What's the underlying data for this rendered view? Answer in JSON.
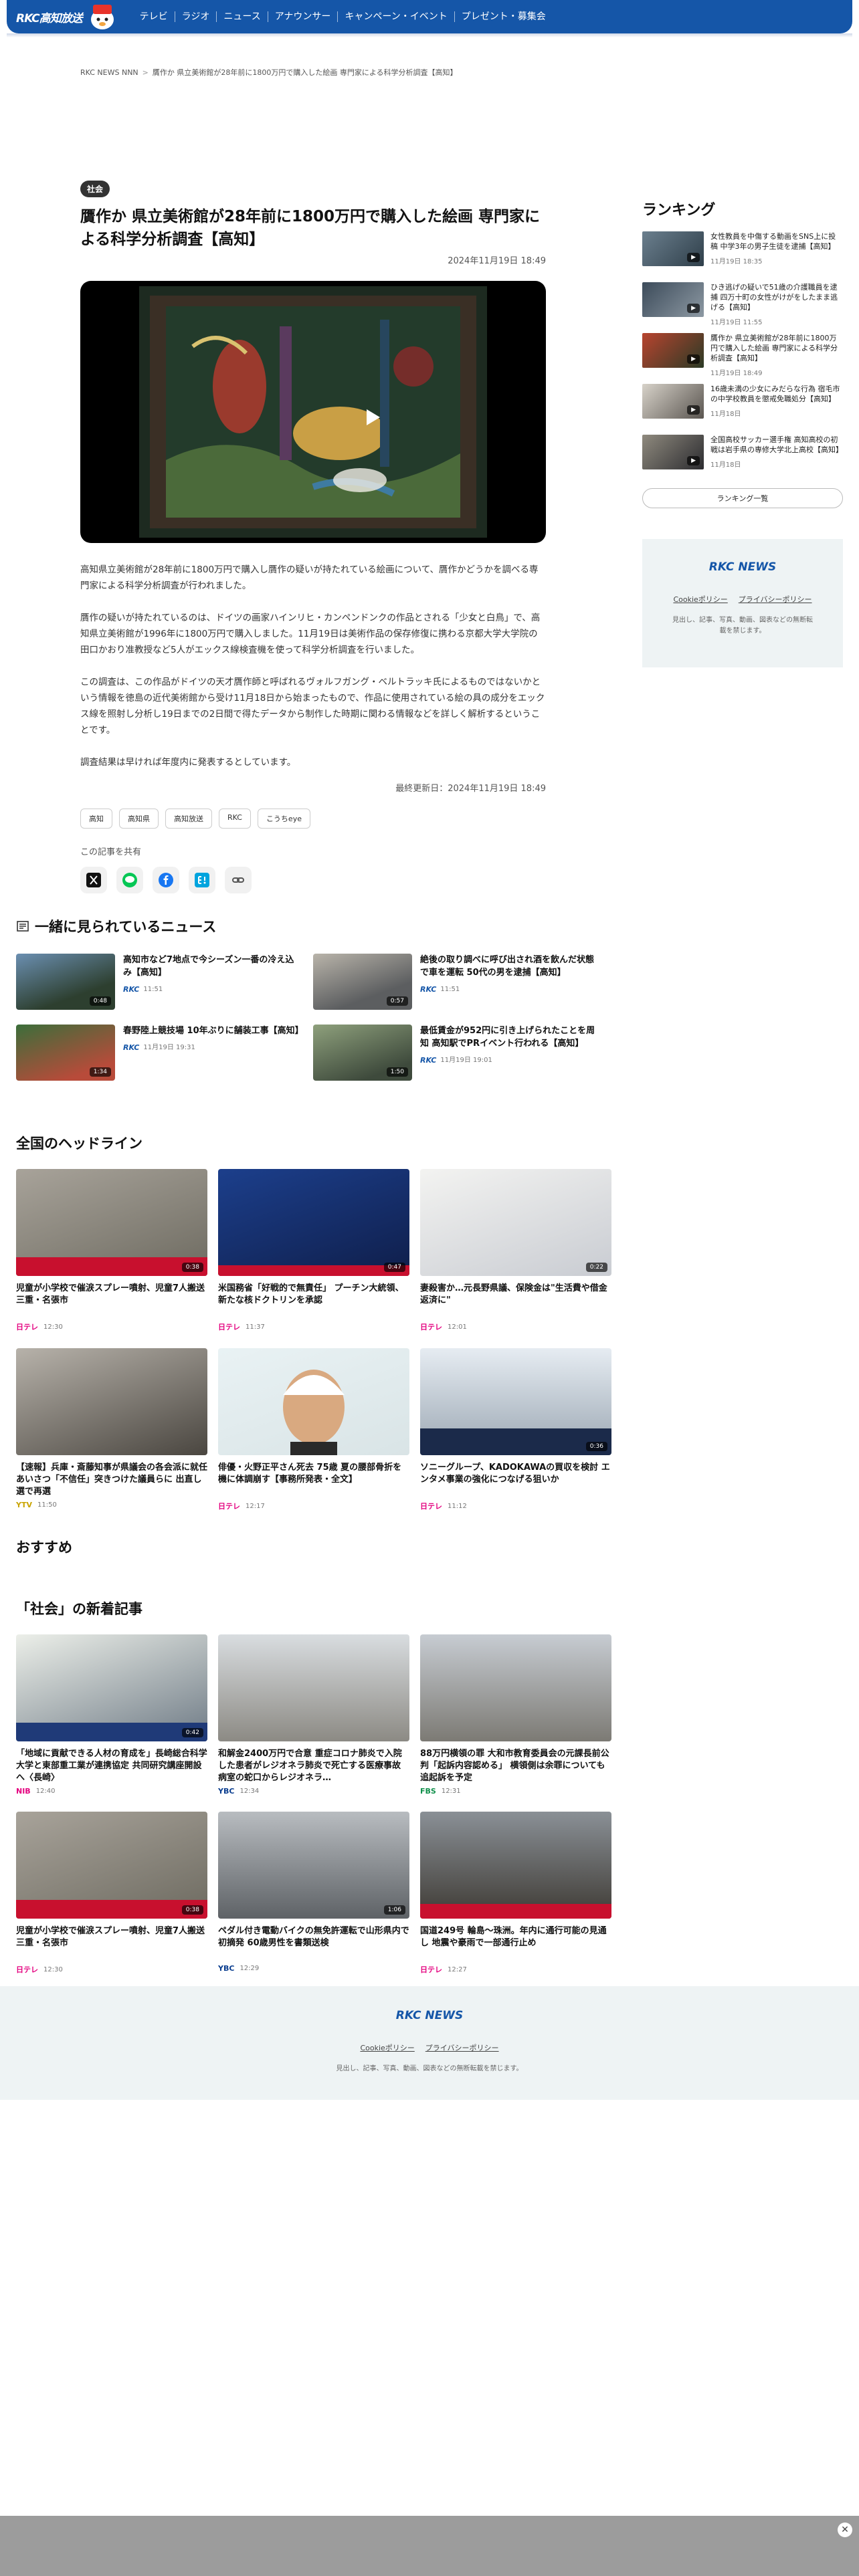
{
  "header": {
    "logo": "RKC高知放送",
    "nav": [
      "テレビ",
      "ラジオ",
      "ニュース",
      "アナウンサー",
      "キャンペーン・イベント",
      "プレゼント・募集会"
    ]
  },
  "breadcrumb": [
    "RKC NEWS NNN",
    "贋作か 県立美術館が28年前に1800万円で購入した絵画 専門家による科学分析調査【高知】"
  ],
  "article": {
    "category": "社会",
    "title": "贋作か 県立美術館が28年前に1800万円で購入した絵画 専門家による科学分析調査【高知】",
    "date": "2024年11月19日 18:49",
    "paragraphs": [
      "高知県立美術館が28年前に1800万円で購入し贋作の疑いが持たれている絵画について、贋作かどうかを調べる専門家による科学分析調査が行われました。",
      "贋作の疑いが持たれているのは、ドイツの画家ハインリヒ・カンペンドンクの作品とされる「少女と白鳥」で、高知県立美術館が1996年に1800万円で購入しました。11月19日は美術作品の保存修復に携わる京都大学大学院の田口かおり准教授など5人がエックス線検査機を使って科学分析調査を行いました。",
      "この調査は、この作品がドイツの天才贋作師と呼ばれるヴォルフガング・ベルトラッキ氏によるものではないかという情報を徳島の近代美術館から受け11月18日から始まったもので、作品に使用されている絵の具の成分をエックス線を照射し分析し19日までの2日間で得たデータから制作した時期に関わる情報などを詳しく解析するということです。",
      "調査結果は早ければ年度内に発表するとしています。"
    ],
    "updated": "最終更新日：2024年11月19日 18:49",
    "tags": [
      "高知",
      "高知県",
      "高知放送",
      "RKC",
      "こうちeye"
    ],
    "share_label": "この記事を共有"
  },
  "ranking": {
    "title": "ランキング",
    "items": [
      {
        "text": "女性教員を中傷する動画をSNS上に投稿 中学3年の男子生徒を逮捕【高知】",
        "date": "11月19日 18:35"
      },
      {
        "text": "ひき逃げの疑いで51歳の介護職員を逮捕 四万十町の女性がけがをしたまま逃げる【高知】",
        "date": "11月19日 11:55"
      },
      {
        "text": "贋作か 県立美術館が28年前に1800万円で購入した絵画 専門家による科学分析調査【高知】",
        "date": "11月19日 18:49"
      },
      {
        "text": "16歳未満の少女にみだらな行為 宿毛市の中学校教員を懲戒免職処分【高知】",
        "date": "11月18日"
      },
      {
        "text": "全国高校サッカー選手権 高知高校の初戦は岩手県の専修大学北上高校【高知】",
        "date": "11月18日"
      }
    ],
    "button": "ランキング一覧"
  },
  "side_box": {
    "logo": "RKC NEWS",
    "links": [
      "Cookieポリシー",
      "プライバシーポリシー"
    ],
    "notice": "見出し、記事、写真、動画、図表などの無断転載を禁じます。"
  },
  "related": {
    "title": "一緒に見られているニュース",
    "items": [
      {
        "text": "高知市など7地点で今シーズン一番の冷え込み【高知】",
        "source": "RKC",
        "time": "11:51",
        "duration": "0:48"
      },
      {
        "text": "絶後の取り調べに呼び出され酒を飲んだ状態で車を運転 50代の男を逮捕【高知】",
        "source": "RKC",
        "time": "11:51",
        "duration": "0:57"
      },
      {
        "text": "春野陸上競技場 10年ぶりに舗装工事【高知】",
        "source": "RKC",
        "time": "11月19日 19:31",
        "duration": "1:34"
      },
      {
        "text": "最低賃金が952円に引き上げられたことを周知 高知駅でPRイベント行われる【高知】",
        "source": "RKC",
        "time": "11月19日 19:01",
        "duration": "1:50"
      }
    ]
  },
  "headlines": {
    "title": "全国のヘッドライン",
    "items": [
      {
        "text": "児童が小学校で催涙スプレー噴射、児童7人搬送 三重・名張市",
        "brand": "日テレ",
        "time": "12:30",
        "duration": "0:38"
      },
      {
        "text": "米国務省「好戦的で無責任」 プーチン大統領、新たな核ドクトリンを承認",
        "brand": "日テレ",
        "time": "11:37",
        "duration": "0:47"
      },
      {
        "text": "妻殺害か…元長野県議、保険金は\"生活費や借金返済に\"",
        "brand": "日テレ",
        "time": "12:01",
        "duration": "0:22"
      },
      {
        "text": "【速報】兵庫・斎藤知事が県議会の各会派に就任あいさつ「不信任」突きつけた議員らに 出直し選で再選",
        "brand": "YTV",
        "time": "11:50",
        "duration": ""
      },
      {
        "text": "俳優・火野正平さん死去 75歳 夏の腰部骨折を機に体調崩す【事務所発表・全文】",
        "brand": "日テレ",
        "time": "12:17",
        "duration": ""
      },
      {
        "text": "ソニーグループ、KADOKAWAの買収を検討 エンタメ事業の強化につなげる狙いか",
        "brand": "日テレ",
        "time": "11:12",
        "duration": "0:36"
      }
    ]
  },
  "recommend": {
    "title": "おすすめ"
  },
  "social": {
    "title": "「社会」の新着記事",
    "items": [
      {
        "text": "「地域に貢献できる人材の育成を」長崎総合科学大学と東部重工業が連携協定 共同研究講座開設へ〈長崎〉",
        "brand": "NIB",
        "time": "12:40",
        "duration": "0:42"
      },
      {
        "text": "和解金2400万円で合意 重症コロナ肺炎で入院した患者がレジオネラ肺炎で死亡する医療事故 病室の蛇口からレジオネラ…",
        "brand": "YBC",
        "time": "12:34",
        "duration": ""
      },
      {
        "text": "88万円横領の罪 大和市教育委員会の元課長前公判「起訴内容認める」 横領側は余罪についても追起訴を予定",
        "brand": "FBS",
        "time": "12:31",
        "duration": ""
      },
      {
        "text": "児童が小学校で催涙スプレー噴射、児童7人搬送 三重・名張市",
        "brand": "日テレ",
        "time": "12:30",
        "duration": "0:38"
      },
      {
        "text": "ペダル付き電動バイクの無免許運転で山形県内で初摘発 60歳男性を書類送検",
        "brand": "YBC",
        "time": "12:29",
        "duration": "1:06"
      },
      {
        "text": "国道249号 輪島〜珠洲。年内に通行可能の見通し 地震や豪雨で一部通行止め",
        "brand": "日テレ",
        "time": "12:27",
        "duration": ""
      }
    ]
  },
  "footer": {
    "logo": "RKC NEWS",
    "links": [
      "Cookieポリシー",
      "プライバシーポリシー"
    ],
    "notice": "見出し、記事、写真、動画、図表などの無断転載を禁じます。"
  }
}
